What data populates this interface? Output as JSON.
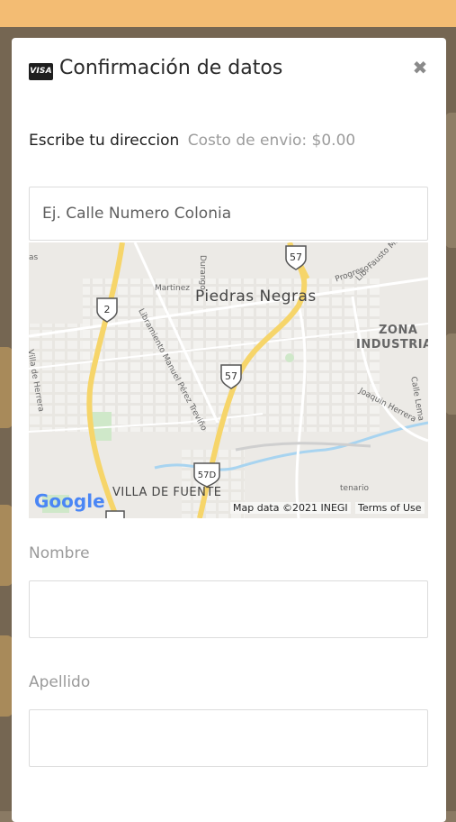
{
  "modal": {
    "card_icon": "VISA",
    "title": "Confirmación de datos",
    "close_icon": "✖"
  },
  "address": {
    "label": "Escribe tu direccion",
    "shipping_cost": "Costo de envio: $0.00",
    "placeholder": "Ej. Calle Numero Colonia"
  },
  "map": {
    "city": "Piedras Negras",
    "district": "VILLA DE FUENTE",
    "zone_line1": "ZONA",
    "zone_line2": "INDUSTRIA",
    "streets": {
      "martinez": "Martinez",
      "durango": "Durango",
      "progreso": "Progreso",
      "fausto": "Lib. Fausto Martinez",
      "libramiento": "Libramiento Manuel Pérez Treviño",
      "villa_herrera": "Villa de Herrera",
      "joaquin": "Joaquin Herrera",
      "calle": "Calle Lema",
      "tenario": "tenario",
      "as": "as"
    },
    "shields": {
      "s2": "2",
      "s57_top": "57",
      "s57_mid": "57",
      "s57d": "57D"
    },
    "google_logo": "Google",
    "attribution": "Map data ©2021 INEGI",
    "terms": "Terms of Use"
  },
  "form": {
    "nombre_label": "Nombre",
    "apellido_label": "Apellido"
  }
}
